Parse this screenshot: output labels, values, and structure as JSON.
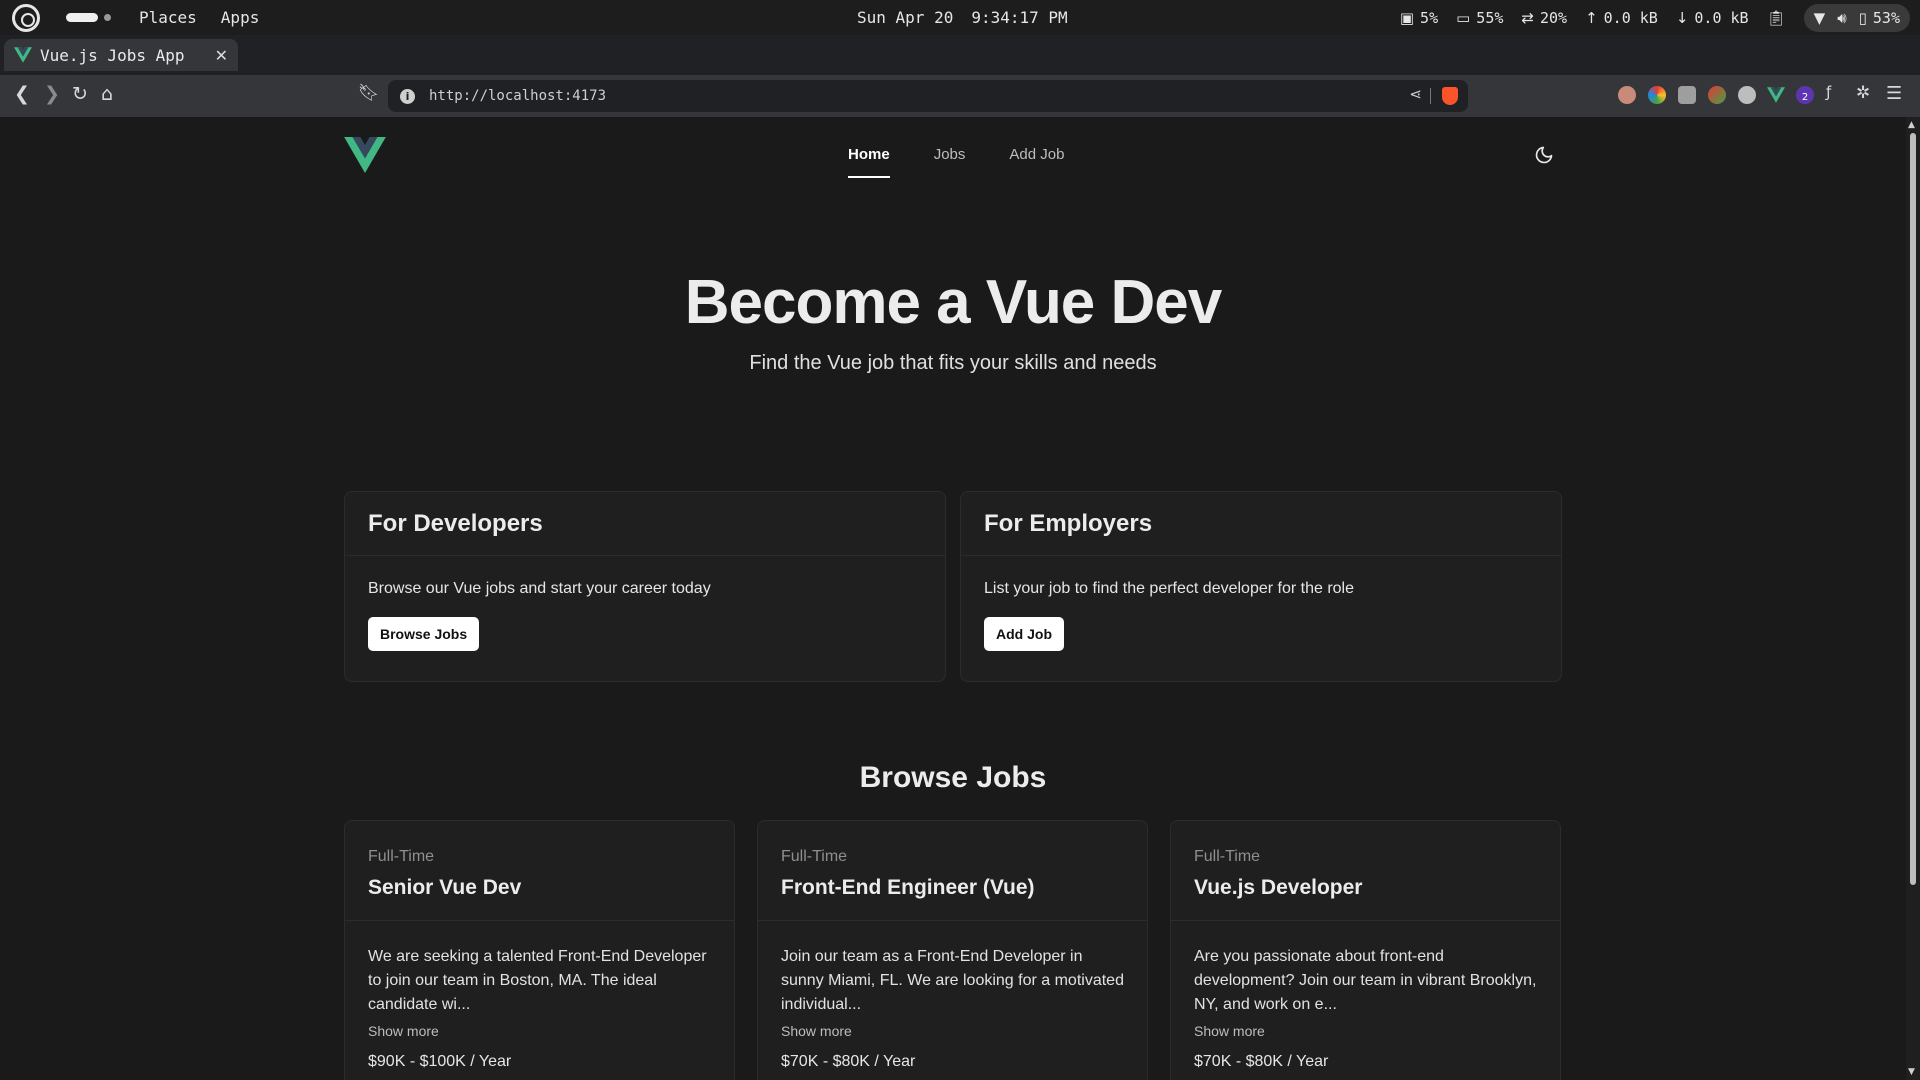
{
  "system_bar": {
    "menus": [
      "Places",
      "Apps"
    ],
    "date": "Sun Apr 20",
    "time": "9:34:17 PM",
    "cpu": "5%",
    "memory": "55%",
    "swap": "20%",
    "upload": "0.0 kB",
    "download": "0.0 kB",
    "battery": "53%"
  },
  "browser": {
    "tab_title": "Vue.js Jobs App",
    "url": "http://localhost:4173",
    "extension_badge": "2"
  },
  "nav": {
    "links": [
      "Home",
      "Jobs",
      "Add Job"
    ],
    "active": "Home"
  },
  "hero": {
    "title": "Become a Vue Dev",
    "subtitle": "Find the Vue job that fits your skills and needs"
  },
  "cards": [
    {
      "title": "For Developers",
      "text": "Browse our Vue jobs and start your career today",
      "button": "Browse Jobs"
    },
    {
      "title": "For Employers",
      "text": "List your job to find the perfect developer for the role",
      "button": "Add Job"
    }
  ],
  "browse": {
    "title": "Browse Jobs",
    "show_more": "Show more",
    "jobs": [
      {
        "type": "Full-Time",
        "title": "Senior Vue Dev",
        "description": "We are seeking a talented Front-End Developer to join our team in Boston, MA. The ideal candidate wi...",
        "salary": "$90K - $100K / Year"
      },
      {
        "type": "Full-Time",
        "title": "Front-End Engineer (Vue)",
        "description": "Join our team as a Front-End Developer in sunny Miami, FL. We are looking for a motivated individual...",
        "salary": "$70K - $80K / Year"
      },
      {
        "type": "Full-Time",
        "title": "Vue.js Developer",
        "description": "Are you passionate about front-end development? Join our team in vibrant Brooklyn, NY, and work on e...",
        "salary": "$70K - $80K / Year"
      }
    ]
  },
  "colors": {
    "vue_green": "#41b883",
    "vue_dark": "#34495e",
    "page_bg": "#1a1a1a",
    "card_bg": "#1f1f1f"
  }
}
